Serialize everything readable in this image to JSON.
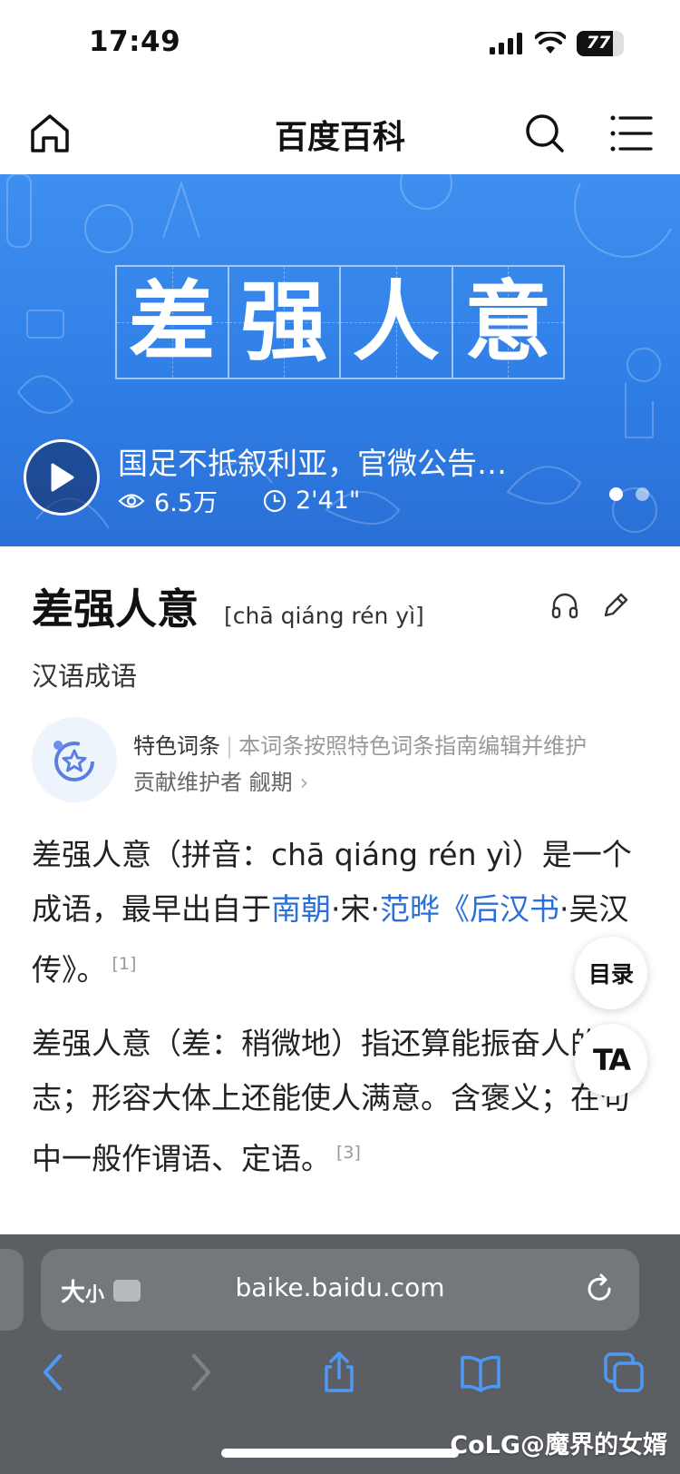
{
  "status_bar": {
    "time": "17:49",
    "battery": "77"
  },
  "nav": {
    "title": "百度百科"
  },
  "banner": {
    "chars": [
      "差",
      "强",
      "人",
      "意"
    ],
    "video_title": "国足不抵叙利亚，官微公告…",
    "views": "6.5万",
    "duration": "2'41\""
  },
  "entry": {
    "title": "差强人意",
    "pinyin": "[chā qiáng rén yì]",
    "subtitle": "汉语成语"
  },
  "feature": {
    "label": "特色词条",
    "desc": "本词条按照特色词条指南编辑并维护",
    "contributor": "贡献维护者 觎期",
    "chevron": "›"
  },
  "paragraph1": {
    "t1": "差强人意（拼音：chā qiáng rén yì）是一个成语，最早出自于",
    "link1": "南朝",
    "t2": "·宋·",
    "link2": "范晔",
    "t3": "《",
    "link3": "后汉书",
    "t4": "·吴汉传》。",
    "ref": "[1]"
  },
  "paragraph2": {
    "text": "差强人意（差：稍微地）指还算能振奋人的意志；形容大体上还能使人满意。含褒义；在句中一般作谓语、定语。",
    "ref": "[3]"
  },
  "floating": {
    "toc": "目录",
    "ta": "TA"
  },
  "browser": {
    "size_label": "大",
    "size_small": "小",
    "url": "baike.baidu.com"
  },
  "watermark": "CoLG@魔界的女婿",
  "colors": {
    "accent": "#2b6fd8",
    "banner": "#3a88ef",
    "browser_bg": "#5b5e63"
  },
  "icons": [
    "home-icon",
    "search-icon",
    "menu-icon",
    "play-icon",
    "eye-icon",
    "clock-icon",
    "headphones-icon",
    "pencil-icon",
    "star-badge-icon",
    "reload-icon",
    "back-icon",
    "forward-icon",
    "share-icon",
    "bookmarks-icon",
    "tabs-icon"
  ]
}
